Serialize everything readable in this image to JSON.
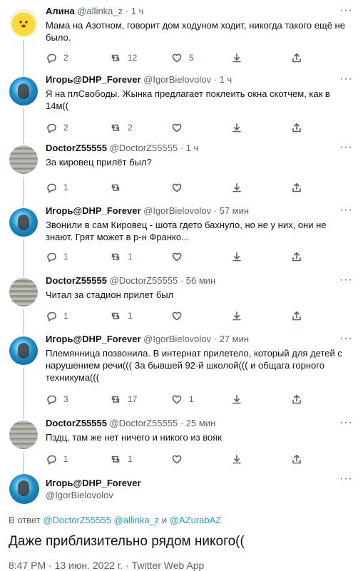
{
  "tweets": [
    {
      "name": "Алина",
      "handle": "@allinka_z",
      "dot": "·",
      "time": "1 ч",
      "text": "Мама на Азотном, говорит дом ходуном ходит, никогда такого ещё не было.",
      "replies": "2",
      "retweets": "12",
      "likes": "5",
      "avatar_icon": "sun-emoji-icon"
    },
    {
      "name": "Игорь@DHP_Forever",
      "handle": "@IgorBielovolov",
      "dot": "·",
      "time": "1 ч",
      "text": "Я на плСвободы. Жынка предлагает поклеить окна скотчем, как в 14м((",
      "replies": "2",
      "retweets": "2",
      "likes": "",
      "avatar_icon": "swimmer-icon"
    },
    {
      "name": "DoctorZ55555",
      "handle": "@DoctorZ55555",
      "dot": "·",
      "time": "1 ч",
      "text": "За кировец прилёт был?",
      "replies": "1",
      "retweets": "",
      "likes": "",
      "avatar_icon": "document-photo-icon"
    },
    {
      "name": "Игорь@DHP_Forever",
      "handle": "@IgorBielovolov",
      "dot": "·",
      "time": "57 мин",
      "text": "Звонили в сам Кировец - шота гдето бахнуло, но не у них, они не знают. Грят может в р-н Франко...",
      "replies": "1",
      "retweets": "1",
      "likes": "",
      "avatar_icon": "swimmer-icon"
    },
    {
      "name": "DoctorZ55555",
      "handle": "@DoctorZ55555",
      "dot": "·",
      "time": "56 мин",
      "text": "Читал за стадион прилет был",
      "replies": "1",
      "retweets": "1",
      "likes": "",
      "avatar_icon": "document-photo-icon"
    },
    {
      "name": "Игорь@DHP_Forever",
      "handle": "@IgorBielovolov",
      "dot": "·",
      "time": "27 мин",
      "text": "Племянница позвонила. В интернат прилетело, который для детей с нарушением речи((( За бывшей 92-й школой((( и общага горного техникума(((",
      "replies": "3",
      "retweets": "17",
      "likes": "1",
      "avatar_icon": "swimmer-icon"
    },
    {
      "name": "DoctorZ55555",
      "handle": "@DoctorZ55555",
      "dot": "·",
      "time": "25 мин",
      "text": "Пздц, там же нет ничего и никого из вояк",
      "replies": "1",
      "retweets": "1",
      "likes": "",
      "avatar_icon": "document-photo-icon"
    }
  ],
  "main": {
    "name": "Игорь@DHP_Forever",
    "handle": "@IgorBielovolov",
    "reply_prefix": "В ответ ",
    "mention1": "@DoctorZ55555",
    "mention2": "@allinka_z",
    "and": " и ",
    "mention3": "@AZurabAZ",
    "text": "Даже приблизительно рядом никого((",
    "meta": "8:47 PM · 13 июн. 2022 г. · Twitter Web App"
  },
  "colors": {
    "link": "#1d9bf0",
    "secondary": "#536471",
    "line": "#cfd9de"
  },
  "more_label": "···"
}
